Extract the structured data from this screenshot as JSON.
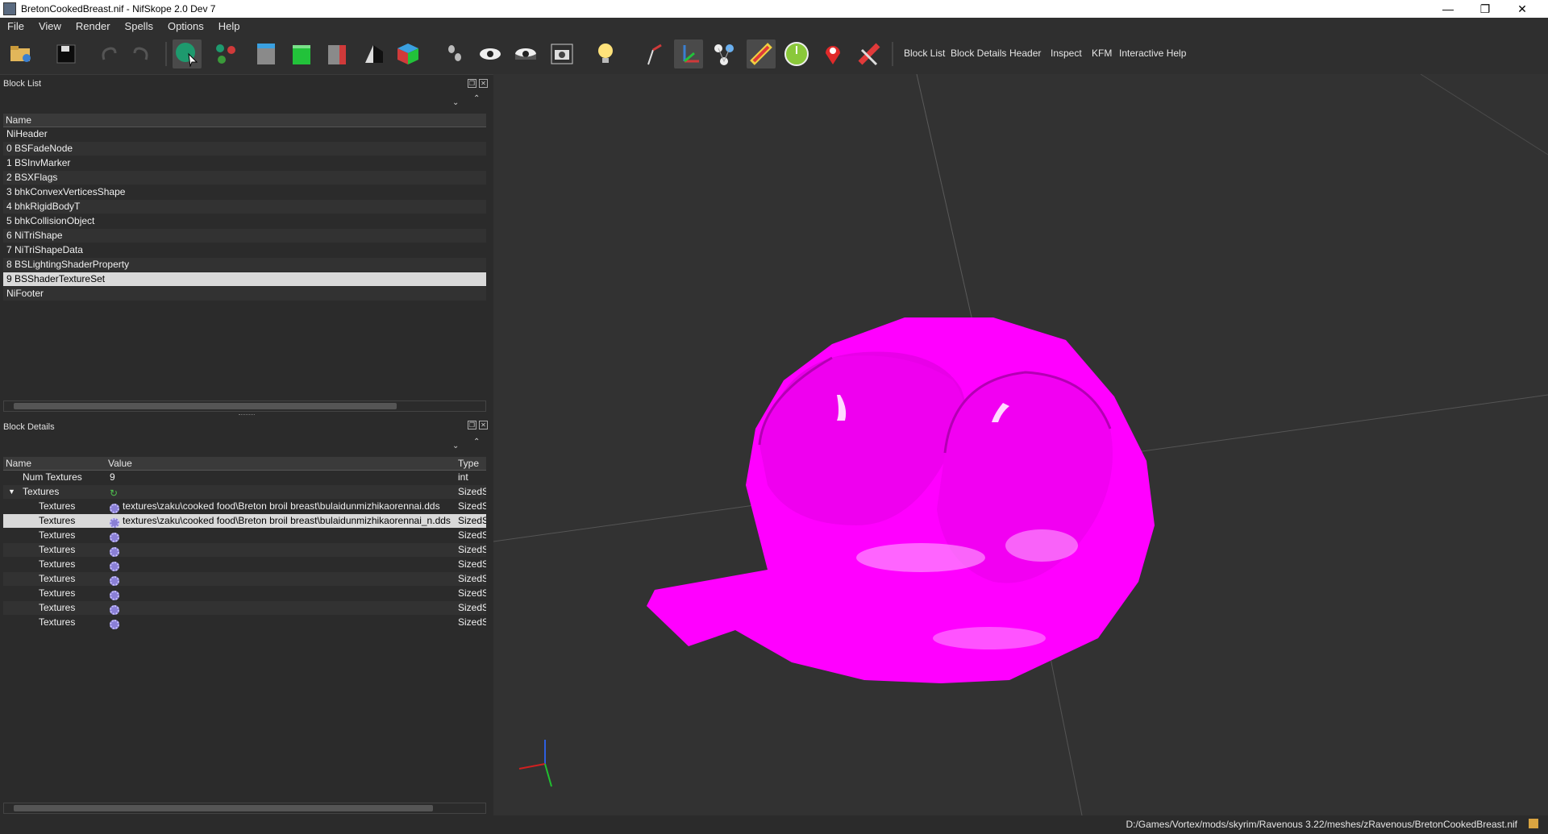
{
  "window": {
    "title": "BretonCookedBreast.nif - NifSkope 2.0 Dev 7",
    "minimize": "—",
    "restore": "❐",
    "close": "✕"
  },
  "menu": [
    "File",
    "View",
    "Render",
    "Spells",
    "Options",
    "Help"
  ],
  "toolbar": {
    "text_buttons": [
      "Block List",
      "Block Details",
      "Header",
      "Inspect",
      "KFM",
      "Interactive Help"
    ]
  },
  "block_list": {
    "title": "Block List",
    "column": "Name",
    "items": [
      "NiHeader",
      "0 BSFadeNode",
      "1 BSInvMarker",
      "2 BSXFlags",
      "3 bhkConvexVerticesShape",
      "4 bhkRigidBodyT",
      "5 bhkCollisionObject",
      "6 NiTriShape",
      "7 NiTriShapeData",
      "8 BSLightingShaderProperty",
      "9 BSShaderTextureSet",
      "NiFooter"
    ],
    "selected_index": 10
  },
  "block_details": {
    "title": "Block Details",
    "columns": [
      "Name",
      "Value",
      "Type"
    ],
    "rows": [
      {
        "name": "Num Textures",
        "value": "9",
        "type": "int"
      },
      {
        "name": "Textures",
        "value": "",
        "type": "SizedSt"
      },
      {
        "name": "Textures",
        "value": "textures\\zaku\\cooked food\\Breton broil breast\\bulaidunmizhikaorennai.dds",
        "type": "SizedSt"
      },
      {
        "name": "Textures",
        "value": "textures\\zaku\\cooked food\\Breton broil breast\\bulaidunmizhikaorennai_n.dds",
        "type": "SizedSt"
      },
      {
        "name": "Textures",
        "value": "",
        "type": "SizedSt"
      },
      {
        "name": "Textures",
        "value": "",
        "type": "SizedSt"
      },
      {
        "name": "Textures",
        "value": "",
        "type": "SizedSt"
      },
      {
        "name": "Textures",
        "value": "",
        "type": "SizedSt"
      },
      {
        "name": "Textures",
        "value": "",
        "type": "SizedSt"
      },
      {
        "name": "Textures",
        "value": "",
        "type": "SizedSt"
      },
      {
        "name": "Textures",
        "value": "",
        "type": "SizedSt"
      }
    ],
    "selected_index": 3
  },
  "status": {
    "path": "D:/Games/Vortex/mods/skyrim/Ravenous 3.22/meshes/zRavenous/BretonCookedBreast.nif"
  },
  "colors": {
    "mesh": "#ff00ff",
    "viewport_bg": "#323232"
  }
}
